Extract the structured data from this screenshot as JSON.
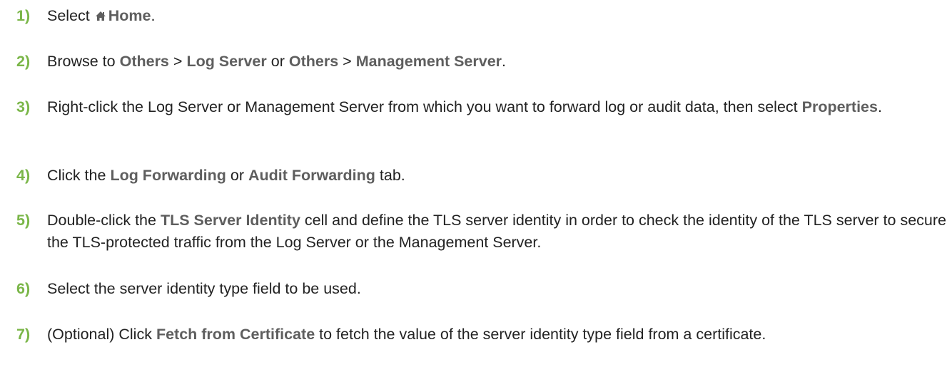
{
  "icons": {
    "home": "home-icon"
  },
  "colors": {
    "step_number": "#7ab648",
    "ui_term": "#5e5e5e",
    "body_text": "#222222"
  },
  "steps": [
    {
      "number": "1)",
      "parts": [
        "Select",
        "Home",
        "."
      ]
    },
    {
      "number": "2)",
      "parts": [
        "Browse to",
        "Others",
        ">",
        "Log Server",
        "or",
        "Others",
        ">",
        "Management Server",
        "."
      ]
    },
    {
      "number": "3)",
      "parts": [
        "Right-click the Log Server or Management Server from which you want to forward log or audit data, then select",
        "Properties",
        "."
      ]
    },
    {
      "number": "4)",
      "parts": [
        "Click the",
        "Log Forwarding",
        "or",
        "Audit Forwarding",
        "tab."
      ]
    },
    {
      "number": "5)",
      "parts": [
        "Double-click the",
        "TLS Server Identity",
        "cell and define the TLS server identity in order to check the identity of the TLS server to secure the TLS-protected traffic from the Log Server or the Management Server."
      ]
    },
    {
      "number": "6)",
      "parts": [
        "Select the server identity type field to be used."
      ]
    },
    {
      "number": "7)",
      "parts": [
        "(Optional) Click",
        "Fetch from Certificate",
        "to fetch the value of the server identity type field from a certificate."
      ]
    }
  ]
}
